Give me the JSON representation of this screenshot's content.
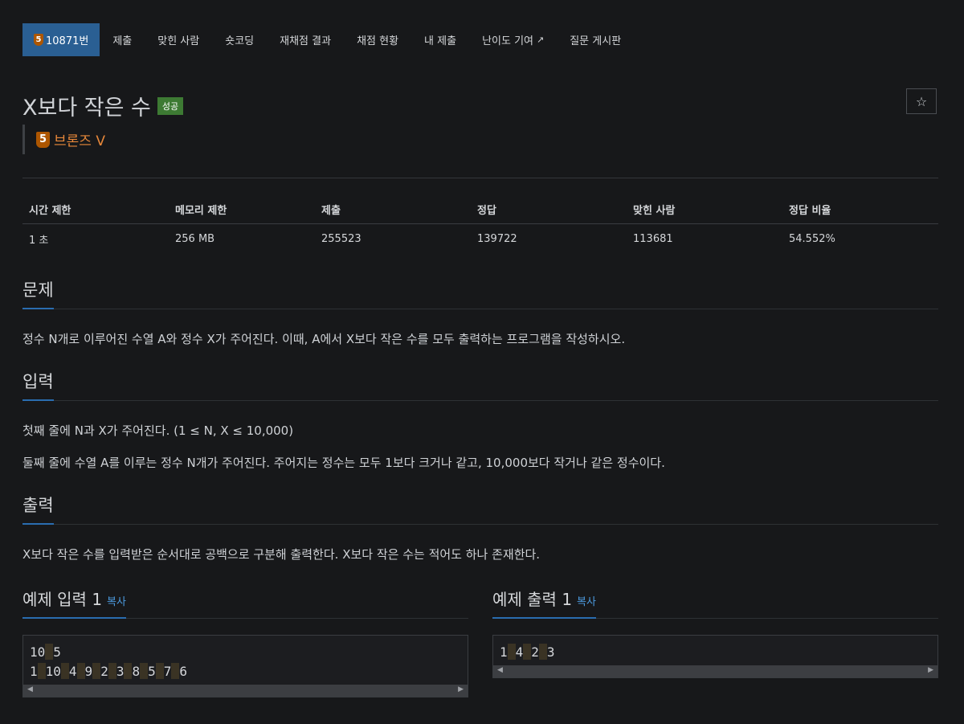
{
  "nav": {
    "tier_number": "5",
    "problem_id": "10871번",
    "items": [
      "제출",
      "맞힌 사람",
      "숏코딩",
      "재채점 결과",
      "채점 현황",
      "내 제출",
      "난이도 기여",
      "질문 게시판"
    ]
  },
  "problem": {
    "title": "X보다 작은 수",
    "status": "성공",
    "tier_number": "5",
    "tier_name": "브론즈 V",
    "star": "☆"
  },
  "info_table": {
    "headers": [
      "시간 제한",
      "메모리 제한",
      "제출",
      "정답",
      "맞힌 사람",
      "정답 비율"
    ],
    "values": [
      "1 초",
      "256 MB",
      "255523",
      "139722",
      "113681",
      "54.552%"
    ]
  },
  "sections": {
    "problem_title": "문제",
    "problem_text": "정수 N개로 이루어진 수열 A와 정수 X가 주어진다. 이때, A에서 X보다 작은 수를 모두 출력하는 프로그램을 작성하시오.",
    "input_title": "입력",
    "input_text_1": "첫째 줄에 N과 X가 주어진다. (1 ≤ N, X ≤ 10,000)",
    "input_text_2": "둘째 줄에 수열 A를 이루는 정수 N개가 주어진다. 주어지는 정수는 모두 1보다 크거나 같고, 10,000보다 작거나 같은 정수이다.",
    "output_title": "출력",
    "output_text": "X보다 작은 수를 입력받은 순서대로 공백으로 구분해 출력한다. X보다 작은 수는 적어도 하나 존재한다."
  },
  "examples": {
    "input_label": "예제 입력 1",
    "output_label": "예제 출력 1",
    "copy_label": "복사",
    "input_lines": [
      [
        "10",
        "5"
      ],
      [
        "1",
        "10",
        "4",
        "9",
        "2",
        "3",
        "8",
        "5",
        "7",
        "6"
      ]
    ],
    "output_lines": [
      [
        "1",
        "4",
        "2",
        "3"
      ]
    ]
  }
}
